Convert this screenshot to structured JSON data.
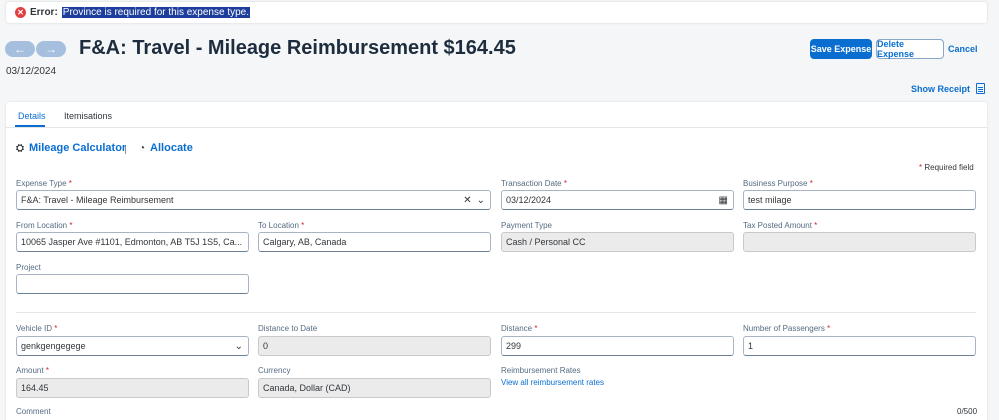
{
  "error": {
    "icon": "error-circle-icon",
    "label": "Error:",
    "message": "Province is required for this expense type."
  },
  "header": {
    "prev_icon": "arrow-left-icon",
    "next_icon": "arrow-right-icon",
    "title": "F&A: Travel - Mileage Reimbursement $164.45",
    "date": "03/12/2024",
    "save_label": "Save Expense",
    "delete_label": "Delete Expense",
    "cancel_label": "Cancel",
    "show_receipt_label": "Show Receipt",
    "receipt_icon": "receipt-icon"
  },
  "tabs": [
    {
      "label": "Details",
      "active": true
    },
    {
      "label": "Itemisations",
      "active": false
    }
  ],
  "actions": {
    "mileage_calculator": "Mileage Calculator",
    "mileage_icon": "calculator-icon",
    "allocate": "Allocate",
    "allocate_icon": "pie-chart-icon"
  },
  "required_note": "Required field",
  "fields": {
    "expense_type": {
      "label": "Expense Type",
      "value": "F&A: Travel - Mileage Reimbursement"
    },
    "transaction_date": {
      "label": "Transaction Date",
      "value": "03/12/2024"
    },
    "business_purpose": {
      "label": "Business Purpose",
      "value": "test milage"
    },
    "from_location": {
      "label": "From Location",
      "value": "10065 Jasper Ave #1101, Edmonton, AB T5J 1S5, Ca..."
    },
    "to_location": {
      "label": "To Location",
      "value": "Calgary, AB, Canada"
    },
    "payment_type": {
      "label": "Payment Type",
      "value": "Cash / Personal CC"
    },
    "tax_posted_amount": {
      "label": "Tax Posted Amount",
      "value": ""
    },
    "project": {
      "label": "Project",
      "value": ""
    },
    "vehicle_id": {
      "label": "Vehicle ID",
      "value": "genkgengegege"
    },
    "distance_to_date": {
      "label": "Distance to Date",
      "value": "0"
    },
    "distance": {
      "label": "Distance",
      "value": "299"
    },
    "passengers": {
      "label": "Number of Passengers",
      "value": "1"
    },
    "amount": {
      "label": "Amount",
      "value": "164.45"
    },
    "currency": {
      "label": "Currency",
      "value": "Canada, Dollar (CAD)"
    },
    "reimbursement_rates": {
      "label": "Reimbursement Rates",
      "link": "View all reimbursement rates"
    },
    "comment": {
      "label": "Comment",
      "counter": "0/500"
    }
  },
  "colors": {
    "accent": "#0a6ed1",
    "error": "#e0403f",
    "required": "#d0222e"
  }
}
